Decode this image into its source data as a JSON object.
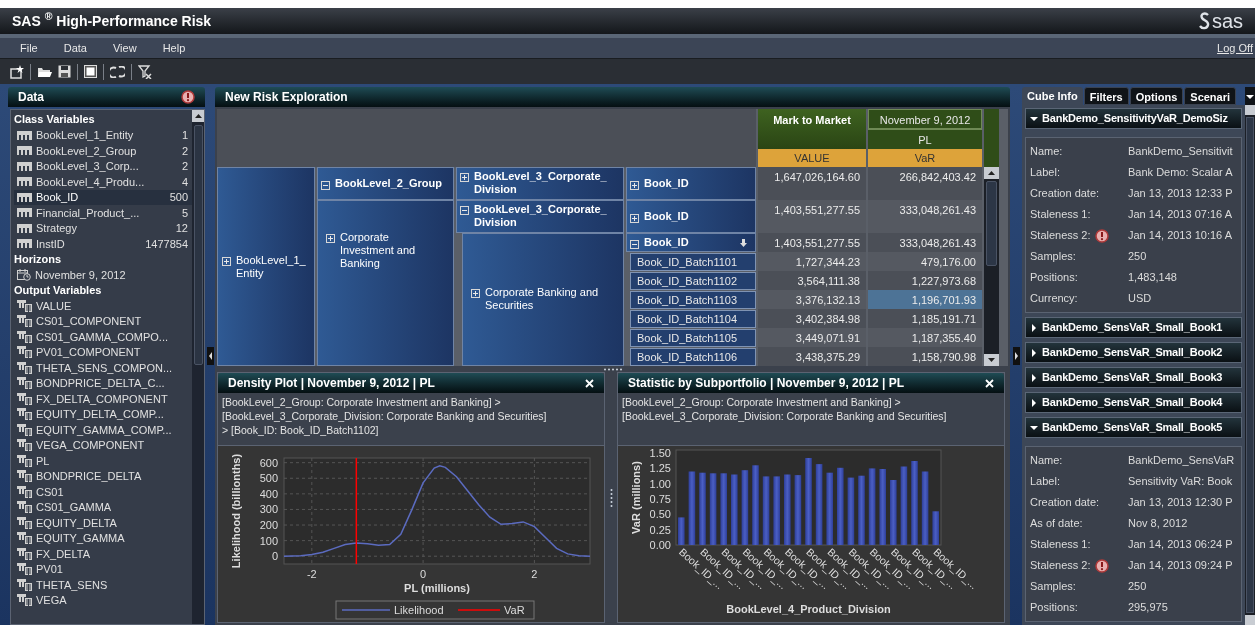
{
  "window": {
    "title": "SAS $^{®}$  High-Performance Risk",
    "logo": "sas"
  },
  "menu": [
    {
      "label": "File"
    },
    {
      "label": "Data"
    },
    {
      "label": "View"
    },
    {
      "label": "Help"
    }
  ],
  "log_off": "Log Off",
  "data_panel": {
    "title": "Data",
    "warning": true,
    "sections": [
      {
        "kind": "class",
        "title": "Class Variables",
        "items": [
          {
            "label": "BookLevel_1_Entity",
            "count": "1",
            "selected": false
          },
          {
            "label": "BookLevel_2_Group",
            "count": "2",
            "selected": false
          },
          {
            "label": "BookLevel_3_Corp...",
            "count": "2",
            "selected": false
          },
          {
            "label": "BookLevel_4_Produ...",
            "count": "4",
            "selected": false
          },
          {
            "label": "Book_ID",
            "count": "500",
            "selected": true
          },
          {
            "label": "Financial_Product_...",
            "count": "5",
            "selected": false
          },
          {
            "label": "Strategy",
            "count": "12",
            "selected": false
          },
          {
            "label": "InstID",
            "count": "1477854",
            "selected": false
          }
        ]
      },
      {
        "kind": "horizon",
        "title": "Horizons",
        "items": [
          {
            "label": "November 9, 2012",
            "selected": false
          }
        ]
      },
      {
        "kind": "output",
        "title": "Output Variables",
        "items": [
          {
            "label": "VALUE",
            "selected": false
          },
          {
            "label": "CS01_COMPONENT",
            "selected": false
          },
          {
            "label": "CS01_GAMMA_COMPO...",
            "selected": false
          },
          {
            "label": "PV01_COMPONENT",
            "selected": false
          },
          {
            "label": "THETA_SENS_COMPON...",
            "selected": false
          },
          {
            "label": "BONDPRICE_DELTA_C...",
            "selected": false
          },
          {
            "label": "FX_DELTA_COMPONENT",
            "selected": false
          },
          {
            "label": "EQUITY_DELTA_COMP...",
            "selected": false
          },
          {
            "label": "EQUITY_GAMMA_COMP...",
            "selected": false
          },
          {
            "label": "VEGA_COMPONENT",
            "selected": false
          },
          {
            "label": "PL",
            "selected": false
          },
          {
            "label": "BONDPRICE_DELTA",
            "selected": false
          },
          {
            "label": "CS01",
            "selected": false
          },
          {
            "label": "CS01_GAMMA",
            "selected": false
          },
          {
            "label": "EQUITY_DELTA",
            "selected": false
          },
          {
            "label": "EQUITY_GAMMA",
            "selected": false
          },
          {
            "label": "FX_DELTA",
            "selected": false
          },
          {
            "label": "PV01",
            "selected": false
          },
          {
            "label": "THETA_SENS",
            "selected": false
          },
          {
            "label": "VEGA",
            "selected": false
          }
        ]
      }
    ]
  },
  "exploration": {
    "title": "New Risk Exploration",
    "pivot": {
      "measure": "Mark to Market",
      "horizon": "November 9, 2012",
      "statistic": "PL",
      "columns": [
        "VALUE",
        "VaR"
      ],
      "entity": {
        "label": "BookLevel_1_Entity",
        "expanded": false
      },
      "group_header": {
        "label": "BookLevel_2_Group",
        "expanded": true
      },
      "group": {
        "label": "Corporate Investment and Banking",
        "expanded": false
      },
      "divisions": [
        {
          "label": "BookLevel_3_Corporate_ Division",
          "expanded": false,
          "book_id": {
            "label": "Book_ID",
            "expanded": false
          },
          "values": [
            "1,647,026,164.60",
            "266,842,403.42"
          ]
        },
        {
          "label": "BookLevel_3_Corporate_ Division",
          "expanded": true,
          "book_id": {
            "label": "Book_ID",
            "expanded": false
          },
          "values": [
            "1,403,551,277.55",
            "333,048,261.43"
          ]
        }
      ],
      "division_value": {
        "label": "Corporate Banking and Securities",
        "expanded": false
      },
      "book_header": {
        "label": "Book_ID",
        "expanded": true,
        "values": [
          "1,403,551,277.55",
          "333,048,261.43"
        ]
      },
      "books": [
        {
          "label": "Book_ID_Batch1101",
          "values": [
            {
              "text": "1,727,344.23",
              "selected": false
            },
            {
              "text": "479,176.00",
              "selected": false
            }
          ]
        },
        {
          "label": "Book_ID_Batch1102",
          "values": [
            {
              "text": "3,564,111.38",
              "selected": false
            },
            {
              "text": "1,227,973.68",
              "selected": false
            }
          ]
        },
        {
          "label": "Book_ID_Batch1103",
          "values": [
            {
              "text": "3,376,132.13",
              "selected": false
            },
            {
              "text": "1,196,701.93",
              "selected": true
            }
          ]
        },
        {
          "label": "Book_ID_Batch1104",
          "values": [
            {
              "text": "3,402,384.98",
              "selected": false
            },
            {
              "text": "1,185,191.71",
              "selected": false
            }
          ]
        },
        {
          "label": "Book_ID_Batch1105",
          "values": [
            {
              "text": "3,449,071.91",
              "selected": false
            },
            {
              "text": "1,187,355.40",
              "selected": false
            }
          ]
        },
        {
          "label": "Book_ID_Batch1106",
          "values": [
            {
              "text": "3,438,375.29",
              "selected": false
            },
            {
              "text": "1,158,790.98",
              "selected": false
            }
          ]
        }
      ]
    },
    "density": {
      "title": "Density Plot | November 9, 2012 | PL",
      "path": [
        "[BookLevel_2_Group: Corporate Investment and Banking] >",
        "[BookLevel_3_Corporate_Division: Corporate Banking and Securities]",
        "> [Book_ID: Book_ID_Batch1102]"
      ],
      "chart_data": {
        "type": "line",
        "xlabel": "PL (millions)",
        "ylabel": "Likelihood (billionths)",
        "x": [
          -2.5,
          -2.2,
          -2,
          -1.8,
          -1.6,
          -1.4,
          -1.2,
          -1,
          -0.8,
          -0.6,
          -0.4,
          -0.2,
          0,
          0.2,
          0.3,
          0.4,
          0.6,
          0.8,
          1,
          1.2,
          1.4,
          1.6,
          1.8,
          2,
          2.2,
          2.4,
          2.6,
          2.8,
          3
        ],
        "series": [
          {
            "name": "Likelihood",
            "color": "#5b6bc0",
            "values": [
              0,
              3,
              10,
              25,
              50,
              75,
              85,
              80,
              70,
              75,
              140,
              300,
              470,
              565,
              580,
              570,
              510,
              420,
              330,
              250,
              205,
              210,
              220,
              190,
              120,
              50,
              15,
              3,
              0
            ]
          }
        ],
        "xlim": [
          -2.5,
          3
        ],
        "ylim": [
          -50,
          630
        ],
        "xticks": [
          -2,
          0,
          2
        ],
        "yticks": [
          0,
          100,
          200,
          300,
          400,
          500,
          600
        ],
        "grid": true,
        "legend": "bottom",
        "ref_lines": [
          {
            "axis": "x",
            "value": -1.2,
            "label": "VaR",
            "color": "#ff0000"
          }
        ]
      }
    },
    "statistic": {
      "title": "Statistic by Subportfolio | November 9, 2012 | PL",
      "path": [
        "[BookLevel_2_Group: Corporate Investment and Banking] >",
        "[BookLevel_3_Corporate_Division: Corporate Banking and Securities]"
      ],
      "chart_data": {
        "type": "bar",
        "xlabel": "BookLevel_4_Product_Division",
        "ylabel": "VaR (millions)",
        "categories": [
          "Book_ID_...",
          null,
          "Book_ID_...",
          null,
          "Book_ID_...",
          null,
          "Book_ID_...",
          null,
          "Book_ID_...",
          null,
          "Book_ID_...",
          null,
          "Book_ID_...",
          null,
          "Book_ID_...",
          null,
          "Book_ID_...",
          null,
          "Book_ID_...",
          null,
          "Book_ID_...",
          null,
          "Book_ID_...",
          null,
          "Book_ID_..."
        ],
        "series": [
          {
            "color": "#4b5fc4",
            "values": [
              0.45,
              1.2,
              1.18,
              1.17,
              1.17,
              1.15,
              1.22,
              1.3,
              1.12,
              1.12,
              1.15,
              1.14,
              1.42,
              1.32,
              1.18,
              1.26,
              1.1,
              1.13,
              1.25,
              1.24,
              1.06,
              1.28,
              1.37,
              1.2,
              0.55
            ]
          }
        ],
        "ylim": [
          0,
          1.55
        ],
        "yticks": [
          {
            "value": 0,
            "label": "0.00"
          },
          {
            "value": 0.25,
            "label": "0.25"
          },
          {
            "value": 0.5,
            "label": "0.50"
          },
          {
            "value": 0.75,
            "label": "0.75"
          },
          {
            "value": 1,
            "label": "1.00"
          },
          {
            "value": 1.25,
            "label": "1.25"
          },
          {
            "value": 1.5,
            "label": "1.50"
          }
        ]
      }
    }
  },
  "side_panel": {
    "tabs": [
      {
        "label": "Cube Info",
        "selected": true
      },
      {
        "label": "Filters",
        "selected": false
      },
      {
        "label": "Options",
        "selected": false
      },
      {
        "label": "Scenari",
        "selected": false
      }
    ],
    "cubes": [
      {
        "name": "BankDemo_SensitivityVaR_DemoSiz",
        "expanded": true,
        "properties": [
          {
            "label": "Name:",
            "value": "BankDemo_Sensitivit",
            "warning": false
          },
          {
            "label": "Label:",
            "value": "Bank Demo: Scalar A",
            "warning": false
          },
          {
            "label": "Creation date:",
            "value": "Jan 13, 2013 12:33 P",
            "warning": false
          },
          {
            "label": "Staleness 1:",
            "value": "Jan 14, 2013 07:16 A",
            "warning": false
          },
          {
            "label": "Staleness 2:",
            "value": "Jan 14, 2013 10:16 A",
            "warning": true
          },
          {
            "label": "Samples:",
            "value": "250",
            "warning": false
          },
          {
            "label": "Positions:",
            "value": "1,483,148",
            "warning": false
          },
          {
            "label": "Currency:",
            "value": "USD",
            "warning": false
          }
        ]
      },
      {
        "name": "BankDemo_SensVaR_Small_Book1",
        "expanded": false
      },
      {
        "name": "BankDemo_SensVaR_Small_Book2",
        "expanded": false
      },
      {
        "name": "BankDemo_SensVaR_Small_Book3",
        "expanded": false
      },
      {
        "name": "BankDemo_SensVaR_Small_Book4",
        "expanded": false
      },
      {
        "name": "BankDemo_SensVaR_Small_Book5",
        "expanded": true,
        "properties": [
          {
            "label": "Name:",
            "value": "BankDemo_SensVaR",
            "warning": false
          },
          {
            "label": "Label:",
            "value": "Sensitivity VaR: Book",
            "warning": false
          },
          {
            "label": "Creation date:",
            "value": "Jan 13, 2013 12:30 P",
            "warning": false
          },
          {
            "label": "As of date:",
            "value": "Nov 8, 2012",
            "warning": false
          },
          {
            "label": "Staleness 1:",
            "value": "Jan 14, 2013 06:24 P",
            "warning": false
          },
          {
            "label": "Staleness 2:",
            "value": "Jan 14, 2013 09:24 P",
            "warning": true
          },
          {
            "label": "Samples:",
            "value": "250",
            "warning": false
          },
          {
            "label": "Positions:",
            "value": "295,975",
            "warning": false
          }
        ]
      }
    ]
  }
}
